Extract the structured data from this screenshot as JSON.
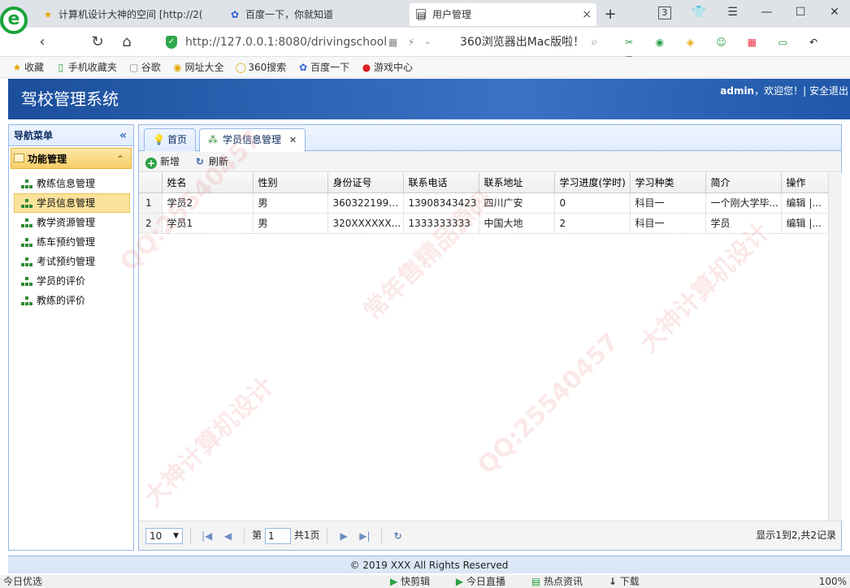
{
  "browser": {
    "tabs": [
      {
        "label": "计算机设计大神的空间 [http://2(",
        "icon": "star-icon"
      },
      {
        "label": "百度一下，你就知道",
        "icon": "baidu-paw-icon"
      },
      {
        "label": "用户管理",
        "icon": "page-icon",
        "active": true
      }
    ],
    "tab_count": "3",
    "url": "http://127.0.0.1:8080/drivingschool",
    "search_hint": "360浏览器出Mac版啦！",
    "bookmarks": [
      "收藏",
      "手机收藏夹",
      "谷歌",
      "网址大全",
      "360搜索",
      "百度一下",
      "游戏中心"
    ]
  },
  "app": {
    "title": "驾校管理系统",
    "user": "admin",
    "welcome": "，欢迎您！|",
    "logout": "安全退出",
    "footer": "© 2019 XXX All Rights Reserved"
  },
  "nav": {
    "title": "导航菜单",
    "section": "功能管理",
    "items": [
      {
        "label": "教练信息管理",
        "selected": false
      },
      {
        "label": "学员信息管理",
        "selected": true
      },
      {
        "label": "教学资源管理",
        "selected": false
      },
      {
        "label": "练车预约管理",
        "selected": false
      },
      {
        "label": "考试预约管理",
        "selected": false
      },
      {
        "label": "学员的评价",
        "selected": false
      },
      {
        "label": "教练的评价",
        "selected": false
      }
    ]
  },
  "main": {
    "tabs": [
      {
        "label": "首页"
      },
      {
        "label": "学员信息管理",
        "active": true
      }
    ],
    "toolbar": {
      "add": "新增",
      "refresh": "刷新"
    },
    "columns": [
      "",
      "姓名",
      "性别",
      "身份证号",
      "联系电话",
      "联系地址",
      "学习进度(学时)",
      "学习种类",
      "简介",
      "操作"
    ],
    "rows": [
      [
        "1",
        "学员2",
        "男",
        "3603221996...",
        "13908343423",
        "四川广安",
        "0",
        "科目一",
        "一个刚大学毕...",
        "编辑 |..."
      ],
      [
        "2",
        "学员1",
        "男",
        "320XXXXXX...",
        "1333333333",
        "中国大地",
        "2",
        "科目一",
        "学员",
        "编辑 |..."
      ]
    ],
    "pager": {
      "page_size": "10",
      "page_prefix": "第",
      "page_num": "1",
      "page_total": "共1页",
      "info": "显示1到2,共2记录"
    }
  },
  "statusbar": {
    "left": "今日优选",
    "items": [
      "快剪辑",
      "今日直播",
      "热点资讯",
      "下载"
    ],
    "zoom": "100%"
  },
  "watermark": {
    "texts": [
      "QQ:25540457",
      "常年售精品源码",
      "大神计算机设计"
    ]
  },
  "colors": {
    "header_blue": "#1b4f9c",
    "panel_border": "#95b8e7",
    "selected_item": "#fbe29b",
    "brand_green": "#19a33a"
  }
}
